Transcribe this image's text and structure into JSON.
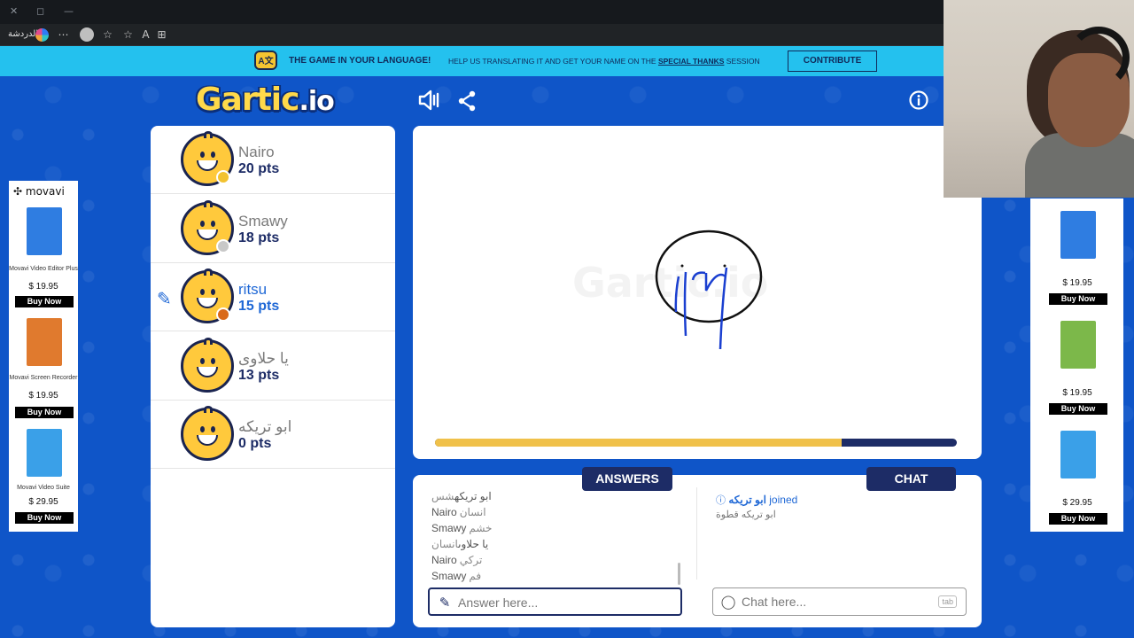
{
  "browser": {
    "tab_label": "الدردشة",
    "controls": [
      "✕",
      "◻",
      "—"
    ]
  },
  "banner": {
    "main": "THE GAME IN YOUR LANGUAGE!",
    "sub_before": "HELP US TRANSLATING IT AND GET YOUR NAME ON THE ",
    "sub_link": "SPECIAL THANKS",
    "sub_after": " SESSION",
    "contribute": "CONTRIBUTE"
  },
  "logo": {
    "text": "Gartic",
    "suffix": ".io"
  },
  "players": [
    {
      "name": "Nairo",
      "points": "20 pts",
      "dot_color": "#f2c230",
      "active": false
    },
    {
      "name": "Smawy",
      "points": "18 pts",
      "dot_color": "#c8c8c8",
      "active": false
    },
    {
      "name": "ritsu",
      "points": "15 pts",
      "dot_color": "#d9691a",
      "active": true
    },
    {
      "name": "يا حلاوى",
      "points": "13 pts",
      "dot_color": "",
      "active": false
    },
    {
      "name": "ابو تريكه",
      "points": "0 pts",
      "dot_color": "",
      "active": false
    }
  ],
  "canvas": {
    "watermark": "Gartic.io",
    "timer_fraction": 0.78
  },
  "answers": {
    "heading": "ANSWERS",
    "messages": [
      {
        "who": "ابو تريكه",
        "text": "شس"
      },
      {
        "who": "Nairo",
        "text": "انسان"
      },
      {
        "who": "Smawy",
        "text": "خشم"
      },
      {
        "who": "يا حلاوى",
        "text": "انسان"
      },
      {
        "who": "Nairo",
        "text": "تركي"
      },
      {
        "who": "Smawy",
        "text": "فم"
      }
    ],
    "placeholder": "Answer here..."
  },
  "chat": {
    "heading": "CHAT",
    "join_name": "ابو تريكه",
    "join_text": "joined",
    "message": "ابو تريكه قطوة",
    "placeholder": "Chat here...",
    "tab_hint": "tab"
  },
  "ads": {
    "brand": "movavi",
    "left": [
      {
        "title": "Movavi Video Editor Plus",
        "price": "$ 19.95",
        "buy": "Buy Now",
        "color": "#2f7de1"
      },
      {
        "title": "Movavi Screen Recorder",
        "price": "$ 19.95",
        "buy": "Buy Now",
        "color": "#e07a2e"
      },
      {
        "title": "Movavi Video Suite",
        "price": "$ 29.95",
        "buy": "Buy Now",
        "color": "#3aa0e8"
      }
    ],
    "right": [
      {
        "price": "$ 19.95",
        "buy": "Buy Now",
        "color": "#2f7de1"
      },
      {
        "price": "$ 19.95",
        "buy": "Buy Now",
        "color": "#7cb84a"
      },
      {
        "price": "$ 29.95",
        "buy": "Buy Now",
        "color": "#3aa0e8"
      }
    ]
  },
  "colors": {
    "page_bg": "#0f55c8",
    "accent_navy": "#1d2c66",
    "banner": "#24c1ee",
    "timer": "#f0c14a",
    "active_player": "#1f68d6"
  }
}
